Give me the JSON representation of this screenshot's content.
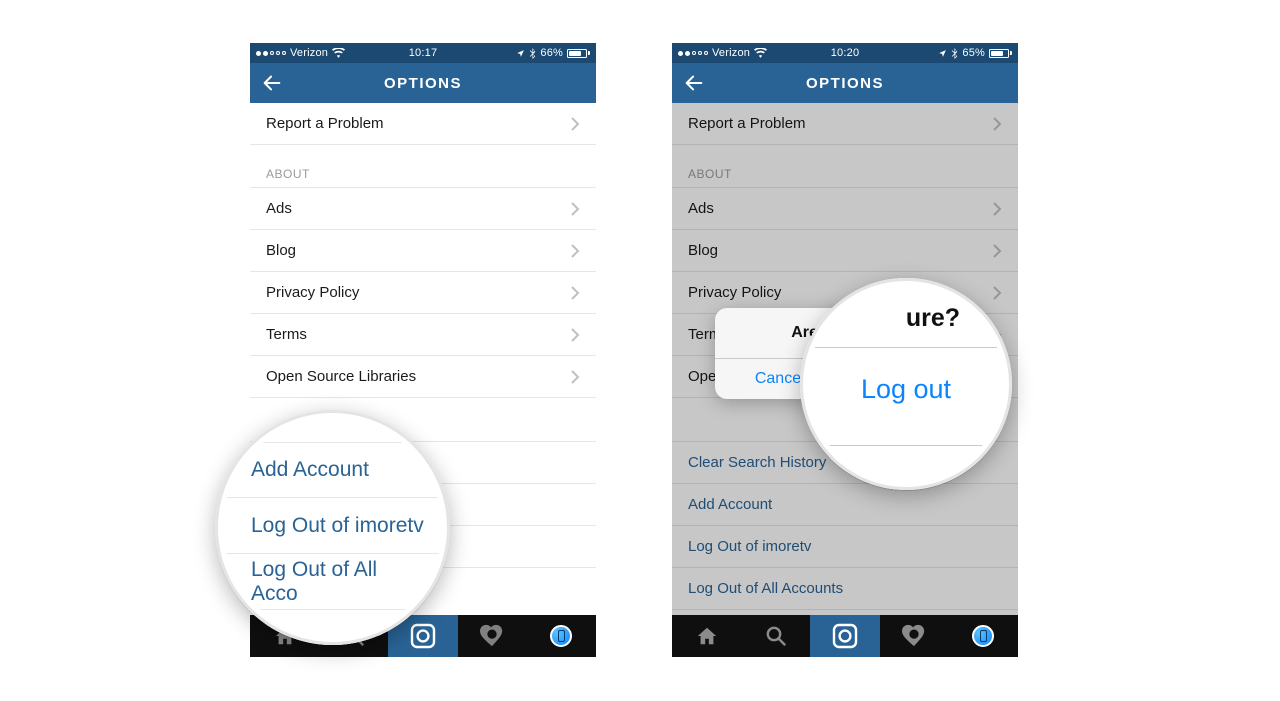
{
  "left": {
    "status": {
      "carrier": "Verizon",
      "time": "10:17",
      "battery_pct": "66%"
    },
    "nav": {
      "title": "OPTIONS"
    },
    "rows": {
      "report": "Report a Problem",
      "about_header": "ABOUT",
      "ads": "Ads",
      "blog": "Blog",
      "privacy": "Privacy Policy",
      "terms": "Terms",
      "opensource": "Open Source Libraries",
      "add_account": "Add Account",
      "logout_one": "Log Out of imoretv",
      "logout_all": "Log Out of All Accounts"
    },
    "magnifier": {
      "peek_top": "",
      "add_account": "Add Account",
      "logout_one": "Log Out of imoretv",
      "logout_all": "Log Out of All Acco"
    }
  },
  "right": {
    "status": {
      "carrier": "Verizon",
      "time": "10:20",
      "battery_pct": "65%"
    },
    "nav": {
      "title": "OPTIONS"
    },
    "rows": {
      "report": "Report a Problem",
      "about_header": "ABOUT",
      "ads": "Ads",
      "blog": "Blog",
      "privacy": "Privacy Policy",
      "terms": "Terms",
      "opensource": "Open Source Libraries",
      "clear_search": "Clear Search History",
      "add_account": "Add Account",
      "logout_one": "Log Out of imoretv",
      "logout_all": "Log Out of All Accounts"
    },
    "alert": {
      "title": "Are you sure?",
      "cancel": "Cancel",
      "confirm": "Log out"
    },
    "magnifier": {
      "title_fragment": "ure?",
      "confirm": "Log out"
    }
  },
  "battery_fill": {
    "left_pct": 66,
    "right_pct": 65
  }
}
